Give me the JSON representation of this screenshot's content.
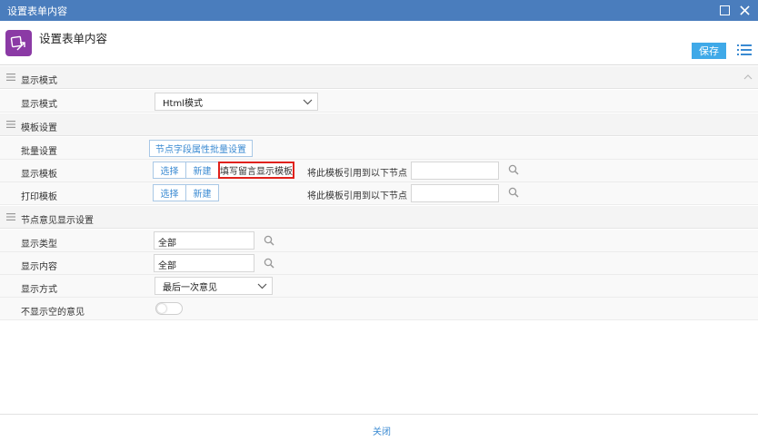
{
  "window": {
    "title": "设置表单内容"
  },
  "header": {
    "title": "设置表单内容",
    "save_label": "保存"
  },
  "sections": {
    "display_mode": "显示模式",
    "template": "模板设置",
    "opinion": "节点意见显示设置"
  },
  "display_mode": {
    "label": "显示模式",
    "value": "Html模式"
  },
  "template": {
    "batch_label": "批量设置",
    "batch_button": "节点字段属性批量设置",
    "display_label": "显示模板",
    "print_label": "打印模板",
    "select_label": "选择",
    "new_label": "新建",
    "fill_message_label": "填写留言显示模板",
    "apply_hint": "将此模板引用到以下节点",
    "display_nodes_value": "",
    "print_nodes_value": ""
  },
  "opinion": {
    "type_label": "显示类型",
    "type_value": "全部",
    "content_label": "显示内容",
    "content_value": "全部",
    "mode_label": "显示方式",
    "mode_value": "最后一次意见",
    "hide_empty_label": "不显示空的意见",
    "hide_empty_on": false
  },
  "footer": {
    "close_label": "关闭"
  },
  "colors": {
    "titlebar": "#4a7dbd",
    "accent": "#3fa9e8",
    "highlight_border": "#e0211b",
    "app_icon": "#8b3aa5"
  }
}
